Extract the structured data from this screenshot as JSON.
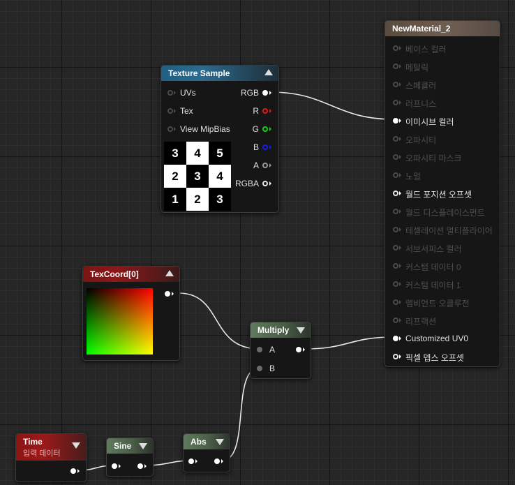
{
  "texture_sample": {
    "title": "Texture Sample",
    "inputs": [
      "UVs",
      "Tex",
      "View MipBias"
    ],
    "outputs": [
      "RGB",
      "R",
      "G",
      "B",
      "A",
      "RGBA"
    ],
    "checker": [
      [
        "3",
        "4",
        "5"
      ],
      [
        "2",
        "3",
        "4"
      ],
      [
        "1",
        "2",
        "3"
      ]
    ]
  },
  "texcoord": {
    "title": "TexCoord[0]"
  },
  "multiply": {
    "title": "Multiply",
    "inputs": [
      "A",
      "B"
    ]
  },
  "time": {
    "title": "Time",
    "subtitle": "입력 데이터"
  },
  "sine": {
    "title": "Sine"
  },
  "abs": {
    "title": "Abs"
  },
  "material": {
    "title": "NewMaterial_2",
    "pins": [
      "베이스 컬러",
      "메탈릭",
      "스페큘러",
      "러프니스",
      "이미시브 컬러",
      "오파시티",
      "오파시티 마스크",
      "노멀",
      "월드 포지션 오프셋",
      "월드 디스플레이스먼트",
      "테셀레이션 멀티플라이어",
      "서브서피스 컬러",
      "커스텀 데이터 0",
      "커스텀 데이터 1",
      "앰비언트 오클루전",
      "리프랙션",
      "Customized UV0",
      "픽셀 뎁스 오프셋"
    ]
  },
  "colors": {
    "wire": "#e8e8e8",
    "pin_r": "#e01818",
    "pin_g": "#17d017",
    "pin_b": "#1a1ae6"
  }
}
